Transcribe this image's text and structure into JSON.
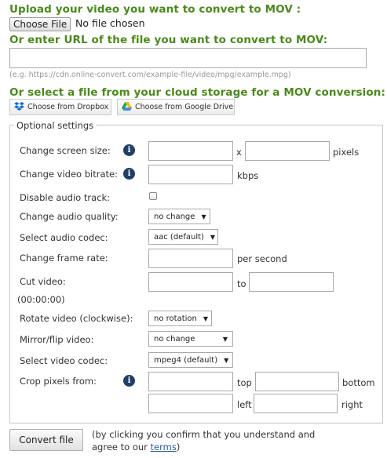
{
  "upload": {
    "heading": "Upload your video you want to convert to MOV :",
    "file_button": "Choose File",
    "file_status": "No file chosen"
  },
  "url": {
    "heading": "Or enter URL of the file you want to convert to MOV:",
    "value": "",
    "hint": "(e.g. https://cdn.online-convert.com/example-file/video/mpg/example.mpg)"
  },
  "cloud": {
    "heading": "Or select a file from your cloud storage for a MOV conversion:",
    "dropbox_label": "Choose from Dropbox",
    "gdrive_label": "Choose from Google Drive"
  },
  "optional": {
    "legend": "Optional settings",
    "screen_size": {
      "label": "Change screen size:",
      "separator": "x",
      "unit": "pixels",
      "width": "",
      "height": ""
    },
    "bitrate": {
      "label": "Change video bitrate:",
      "unit": "kbps",
      "value": ""
    },
    "disable_audio": {
      "label": "Disable audio track:",
      "checked": false
    },
    "audio_quality": {
      "label": "Change audio quality:",
      "selected": "no change"
    },
    "audio_codec": {
      "label": "Select audio codec:",
      "selected": "aac (default)"
    },
    "frame_rate": {
      "label": "Change frame rate:",
      "unit": "per second",
      "value": ""
    },
    "cut_video": {
      "label": "Cut video:",
      "to": "to",
      "format": "(00:00:00)",
      "from_value": "",
      "to_value": ""
    },
    "rotate": {
      "label": "Rotate video (clockwise):",
      "selected": "no rotation"
    },
    "mirror": {
      "label": "Mirror/flip video:",
      "selected": "no change"
    },
    "video_codec": {
      "label": "Select video codec:",
      "selected": "mpeg4 (default)"
    },
    "crop": {
      "label": "Crop pixels from:",
      "top": "top",
      "bottom": "bottom",
      "left": "left",
      "right": "right"
    },
    "info_glyph": "i"
  },
  "actions": {
    "convert_label": "Convert file",
    "note_before": "(by clicking you confirm that you understand and agree to our ",
    "terms_link": "terms",
    "note_after": ")"
  },
  "colors": {
    "heading_green": "#4a8a1a",
    "dropbox_blue": "#0d6fd6",
    "link_blue": "#2a5aa0"
  }
}
